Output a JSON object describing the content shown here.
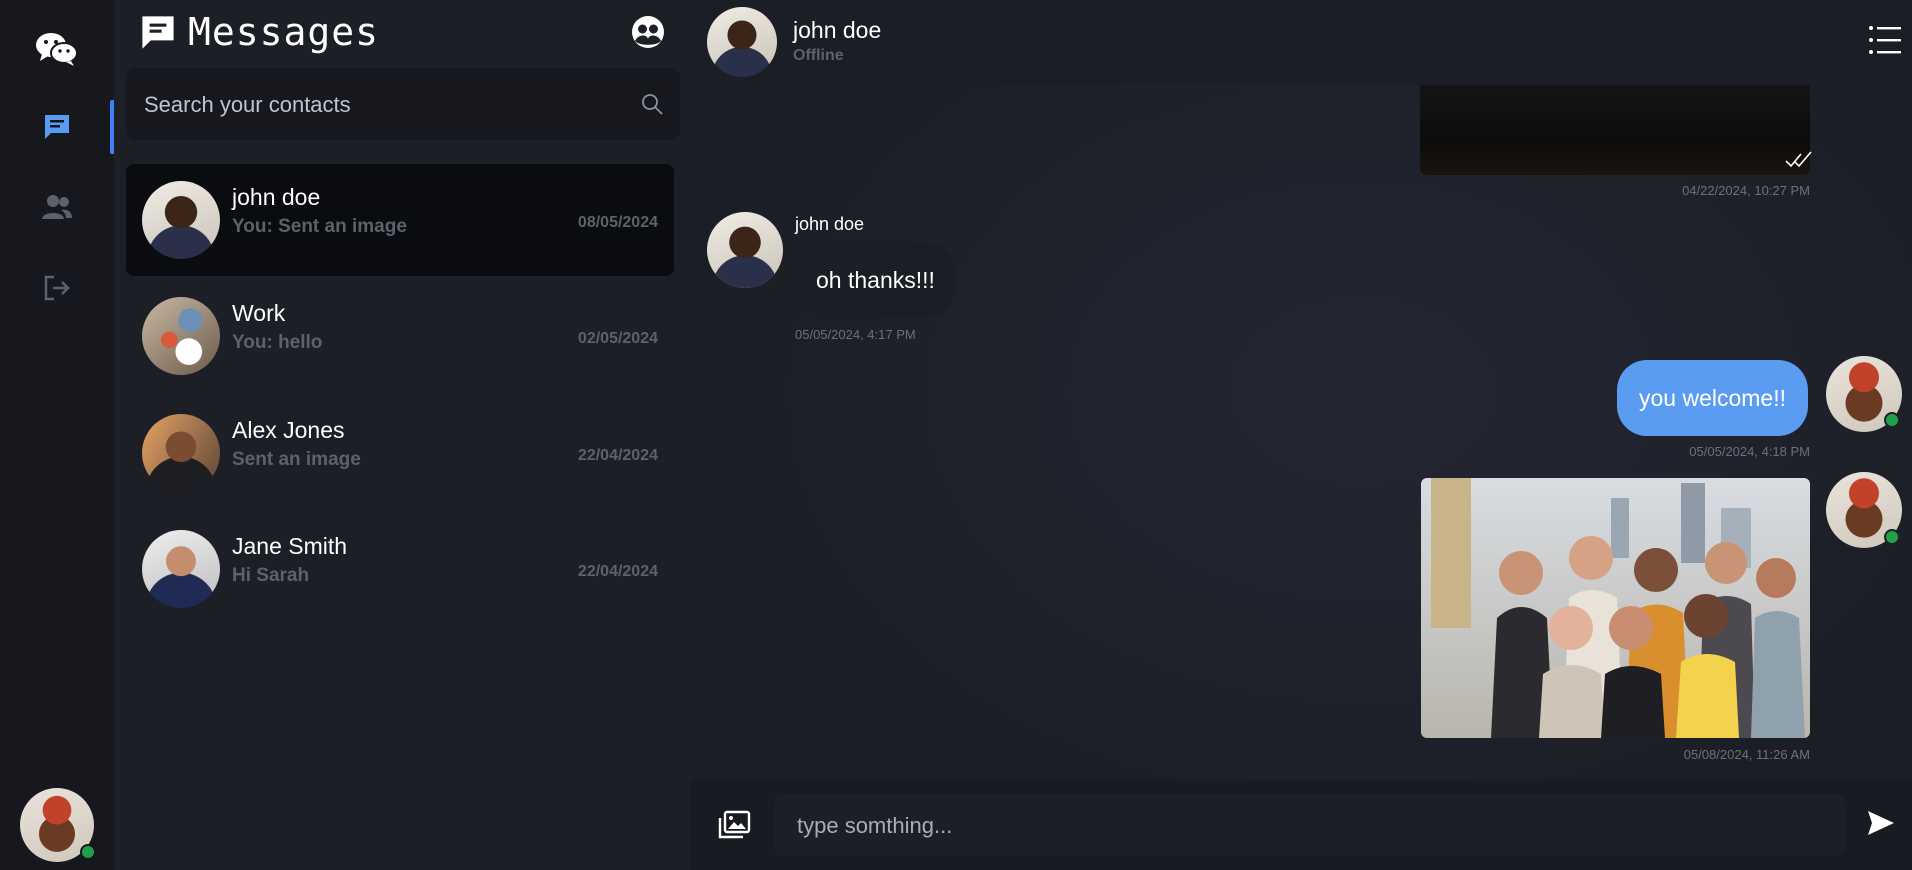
{
  "rail": {
    "icons": [
      "wechat-logo-icon",
      "chat-icon",
      "users-icon",
      "logout-icon"
    ],
    "accent": "#3b82f6"
  },
  "sidebar": {
    "title": "Messages",
    "search_placeholder": "Search your contacts",
    "contacts": [
      {
        "name": "john doe",
        "preview": "You: Sent an image",
        "date": "08/05/2024",
        "active": true
      },
      {
        "name": "Work",
        "preview": "You: hello",
        "date": "02/05/2024",
        "active": false
      },
      {
        "name": "Alex Jones",
        "preview": "Sent an image",
        "date": "22/04/2024",
        "active": false
      },
      {
        "name": "Jane Smith",
        "preview": "Hi Sarah",
        "date": "22/04/2024",
        "active": false
      }
    ]
  },
  "chat": {
    "contact_name": "john doe",
    "contact_status": "Offline",
    "messages": [
      {
        "type": "image",
        "direction": "out",
        "timestamp": "04/22/2024, 10:27 PM",
        "read": true
      },
      {
        "type": "text",
        "direction": "in",
        "sender": "john doe",
        "text": "oh thanks!!!",
        "timestamp": "05/05/2024, 4:17 PM"
      },
      {
        "type": "text",
        "direction": "out",
        "text": "you welcome!!",
        "timestamp": "05/05/2024, 4:18 PM"
      },
      {
        "type": "image",
        "direction": "out",
        "timestamp": "05/08/2024, 11:26 AM"
      }
    ],
    "composer_placeholder": "type somthing...",
    "outgoing_bubble_color": "#5b9cf3",
    "online_color": "#22a049"
  }
}
